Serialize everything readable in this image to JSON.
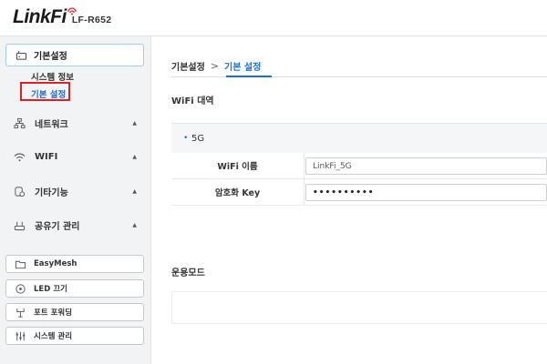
{
  "header": {
    "logo": "LinkFi",
    "model": "LF-R652"
  },
  "sidebar": {
    "active": {
      "label": "기본설정",
      "icon": "router-icon"
    },
    "submenu": [
      {
        "label": "시스템 정보"
      },
      {
        "label": "기본 설정",
        "selected": true
      }
    ],
    "items": [
      {
        "label": "네트워크",
        "icon": "network-icon"
      },
      {
        "label": "WIFI",
        "icon": "wifi-icon"
      },
      {
        "label": "기타기능",
        "icon": "gear-icon"
      },
      {
        "label": "공유기 관리",
        "icon": "router-manage-icon"
      }
    ],
    "buttons": [
      {
        "label": "EasyMesh",
        "icon": "folder-icon"
      },
      {
        "label": "LED 끄기",
        "icon": "led-icon"
      },
      {
        "label": "포트 포워딩",
        "icon": "port-icon"
      },
      {
        "label": "시스템 관리",
        "icon": "system-icon"
      }
    ]
  },
  "main": {
    "breadcrumb": {
      "root": "기본설정",
      "separator": ">",
      "current": "기본 설정"
    },
    "wifi_section_title": "WiFi 대역",
    "band": {
      "bullet": "•",
      "label": "5G"
    },
    "fields": [
      {
        "label": "WiFi 이름",
        "value": "LinkFi_5G"
      },
      {
        "label": "암호화 Key",
        "value": "••••••••••"
      }
    ],
    "mode_section_title": "운용모드"
  },
  "colors": {
    "accent": "#1a73c8",
    "highlight_border": "#e02020",
    "sidebar_bg": "#f2f3f5"
  }
}
